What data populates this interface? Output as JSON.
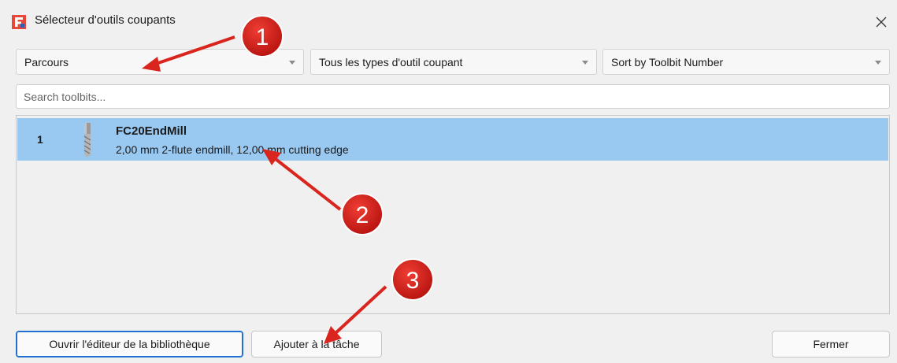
{
  "window": {
    "title": "Sélecteur d'outils coupants",
    "close_glyph": "✕"
  },
  "filters": {
    "library": "Parcours",
    "tool_type": "Tous les types d'outil coupant",
    "sort": "Sort by Toolbit Number"
  },
  "search": {
    "placeholder": "Search toolbits...",
    "value": ""
  },
  "toolbits": [
    {
      "number": "1",
      "name": "FC20EndMill",
      "description": "2,00 mm 2-flute endmill, 12,00 mm cutting edge",
      "icon": "endmill-icon",
      "selected": true
    }
  ],
  "buttons": {
    "open_library_editor": "Ouvrir l'éditeur de la bibliothèque",
    "add_to_job": "Ajouter à la tâche",
    "close": "Fermer"
  },
  "annotations": [
    {
      "label": "1"
    },
    {
      "label": "2"
    },
    {
      "label": "3"
    }
  ],
  "colors": {
    "selection": "#99c9f1",
    "annotation_badge": "#d11f1a",
    "annotation_arrow": "#d9251d",
    "brand": "#e8473a"
  }
}
